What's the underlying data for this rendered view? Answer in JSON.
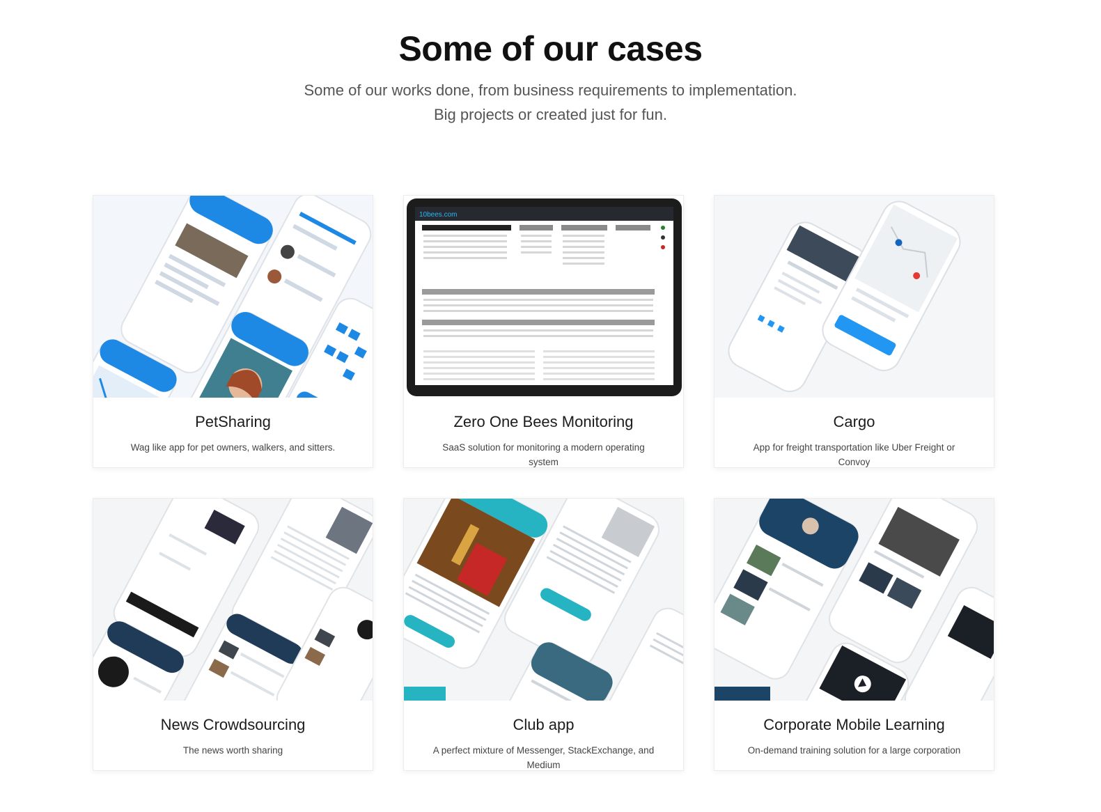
{
  "header": {
    "title": "Some of our cases",
    "subtitle_line1": "Some of our works done, from business requirements to implementation.",
    "subtitle_line2": "Big projects or created just for fun."
  },
  "cases": [
    {
      "title": "PetSharing",
      "description": "Wag like app for pet owners, walkers, and sitters.",
      "accent": "#1e88e5"
    },
    {
      "title": "Zero One Bees Monitoring",
      "description": "SaaS solution for monitoring a modern operating system",
      "accent": "#1f1f1f",
      "tablet_brand": "10bees.com"
    },
    {
      "title": "Cargo",
      "description": "App for freight transportation like Uber Freight or Convoy",
      "accent": "#2196f3"
    },
    {
      "title": "News Crowdsourcing",
      "description": "The news worth sharing",
      "accent": "#1f3b57"
    },
    {
      "title": "Club app",
      "description": "A perfect mixture of Messenger, StackExchange, and Medium",
      "accent": "#26b3c2"
    },
    {
      "title": "Corporate Mobile Learning",
      "description": "On-demand training solution for a large corporation",
      "accent": "#1c4466"
    }
  ]
}
